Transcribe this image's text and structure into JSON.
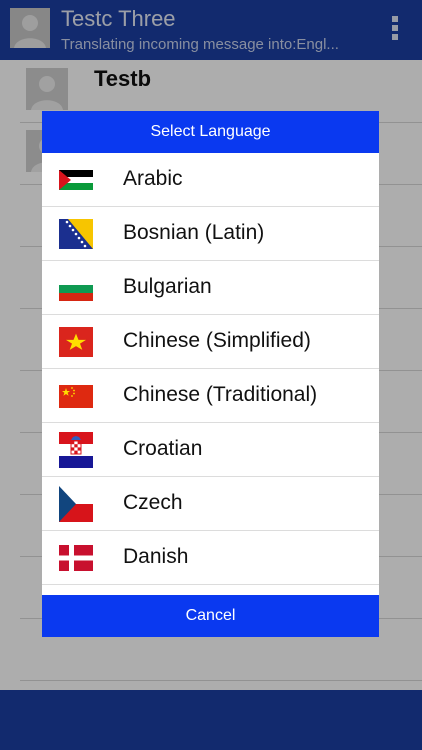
{
  "header": {
    "title": "Testc Three",
    "subtitle": "Translating incoming message into:Engl..."
  },
  "list": {
    "items": [
      {
        "name": "Testb"
      },
      {
        "name": ""
      }
    ]
  },
  "dialog": {
    "title": "Select Language",
    "cancel_label": "Cancel",
    "languages": [
      {
        "label": "Arabic",
        "flag": "arabic-flag-icon"
      },
      {
        "label": "Bosnian (Latin)",
        "flag": "bosnia-flag-icon"
      },
      {
        "label": "Bulgarian",
        "flag": "bulgaria-flag-icon"
      },
      {
        "label": "Chinese (Simplified)",
        "flag": "vietnam-flag-icon"
      },
      {
        "label": "Chinese (Traditional)",
        "flag": "china-flag-icon"
      },
      {
        "label": "Croatian",
        "flag": "croatia-flag-icon"
      },
      {
        "label": "Czech",
        "flag": "czech-flag-icon"
      },
      {
        "label": "Danish",
        "flag": "denmark-flag-icon"
      }
    ]
  },
  "colors": {
    "header_bg": "#1b3fa3",
    "dialog_accent": "#0a39f0"
  }
}
